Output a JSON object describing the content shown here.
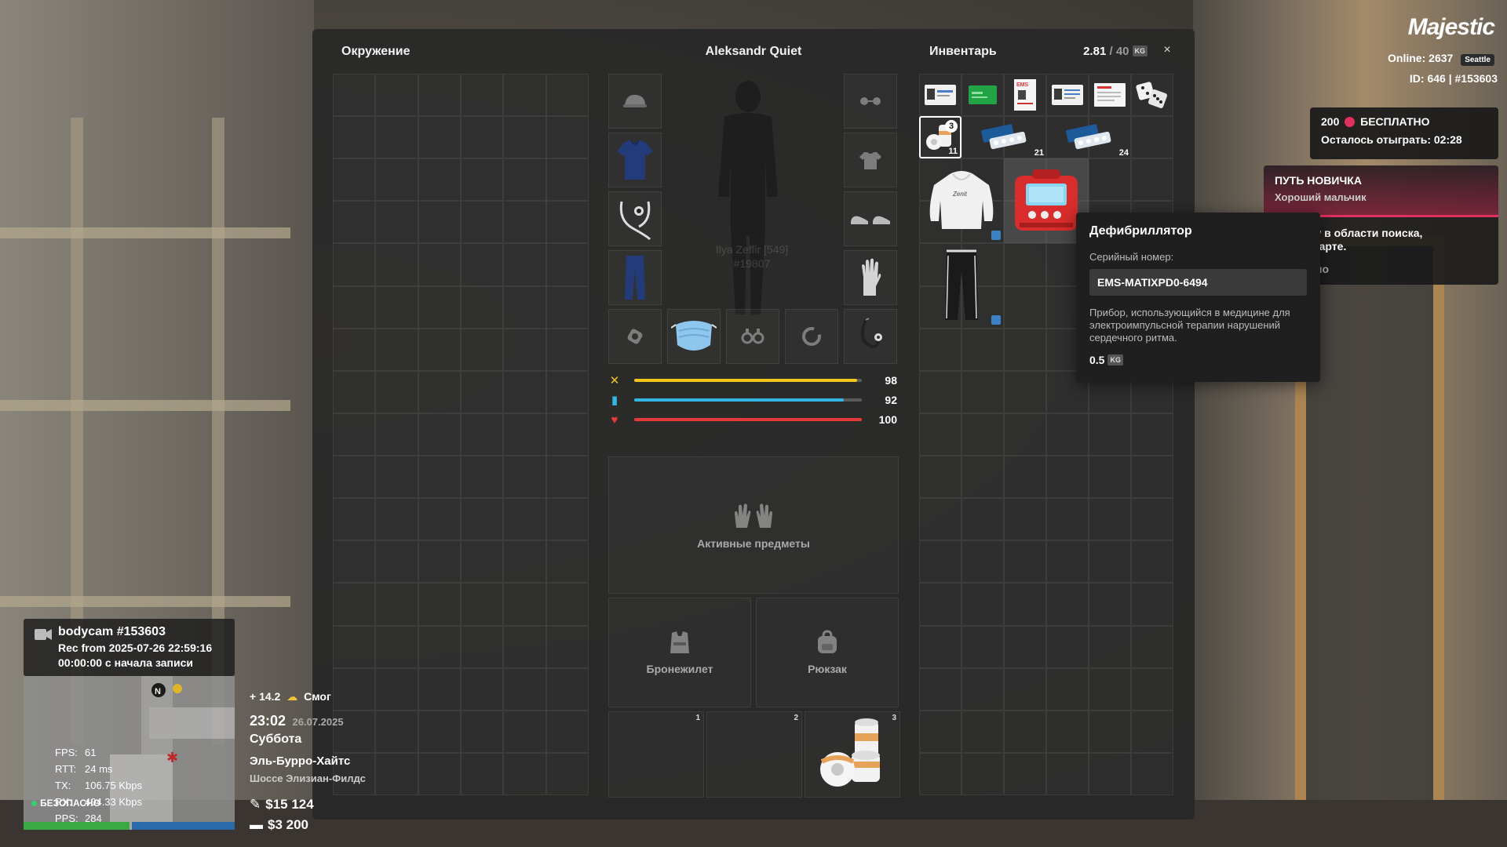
{
  "panel": {
    "environment_title": "Окружение",
    "character_name": "Aleksandr Quiet",
    "ghost_name_line1": "Ilya Zeffir [549]",
    "ghost_name_line2": "#19807",
    "inventory_title": "Инвентарь",
    "weight_current": "2.81",
    "weight_sep": " / ",
    "weight_max": "40",
    "weight_unit": "KG",
    "close_symbol": "×",
    "stats": [
      {
        "name": "hunger",
        "value": 98,
        "color": "#f5c518",
        "label": "98"
      },
      {
        "name": "thirst",
        "value": 92,
        "color": "#34b6e4",
        "label": "92"
      },
      {
        "name": "health",
        "value": 100,
        "color": "#e53a3a",
        "label": "100"
      }
    ],
    "active_items_label": "Активные предметы",
    "armor_label": "Бронежилет",
    "backpack_label": "Рюкзак",
    "quick_slots": [
      "1",
      "2",
      "3"
    ],
    "items": {
      "bandage_badge": "3",
      "bandage_count": "11",
      "pills1_count": "21",
      "pills2_count": "24"
    }
  },
  "tooltip": {
    "title": "Дефибриллятор",
    "serial_label": "Серийный номер:",
    "serial_value": "EMS-MATIXPD0-6494",
    "description": "Прибор, использующийся в медицине для электроимпульсной терапии нарушений сердечного ритма.",
    "weight": "0.5",
    "weight_unit": "KG"
  },
  "hud": {
    "logo": "Majestic",
    "online_label": "Online:",
    "online_value": "2637",
    "server": "Seattle",
    "player_id": "ID: 646 | #153603",
    "promo_amount": "200",
    "promo_free": "БЕСПЛАТНО",
    "promo_remaining_label": "Осталось отыграть:",
    "promo_remaining_time": "02:28",
    "quest_title": "ПУТЬ НОВИЧКА",
    "quest_sub": "Хороший мальчик",
    "quest_text_line1": "е собаку в области поиска,",
    "quest_text_line2": "ной на карте.",
    "quest_status": "авершено",
    "bodycam_title": "bodycam #153603",
    "bodycam_rec": "Rec from 2025-07-26 22:59:16",
    "bodycam_elapsed": "00:00:00 с начала записи",
    "net": [
      {
        "k": "FPS:",
        "v": "61"
      },
      {
        "k": "RTT:",
        "v": "24 ms"
      },
      {
        "k": "TX:",
        "v": "106.75 Kbps"
      },
      {
        "k": "RX:",
        "v": "404.33 Kbps"
      },
      {
        "k": "PPS:",
        "v": "284"
      }
    ],
    "safe_label": "БЕЗОПАСНО",
    "temperature": "+ 14.2",
    "weather": "Смог",
    "time": "23:02",
    "date": "26.07.2025",
    "weekday": "Суббота",
    "district": "Эль-Бурро-Хайтс",
    "street": "Шоссе Элизиан-Филдс",
    "cash": "$15 124",
    "bank": "$3 200",
    "colors": {
      "accent": "#e0305f",
      "hunger": "#f5c518",
      "thirst": "#34b6e4",
      "health": "#e53a3a"
    }
  }
}
